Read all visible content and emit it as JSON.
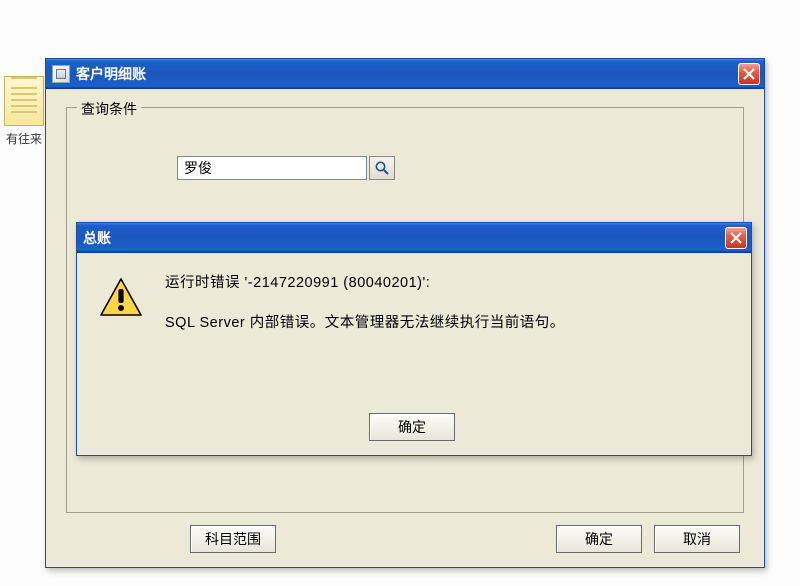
{
  "desktop": {
    "icon_label": "有往来"
  },
  "parent_window": {
    "title": "客户明细账",
    "groupbox_title": "查询条件",
    "search_value": "罗俊",
    "buttons": {
      "scope": "科目范围",
      "ok": "确定",
      "cancel": "取消"
    }
  },
  "error_window": {
    "title": "总账",
    "line1": "运行时错误 '-2147220991 (80040201)':",
    "line2": "SQL Server 内部错误。文本管理器无法继续执行当前语句。",
    "ok": "确定"
  }
}
